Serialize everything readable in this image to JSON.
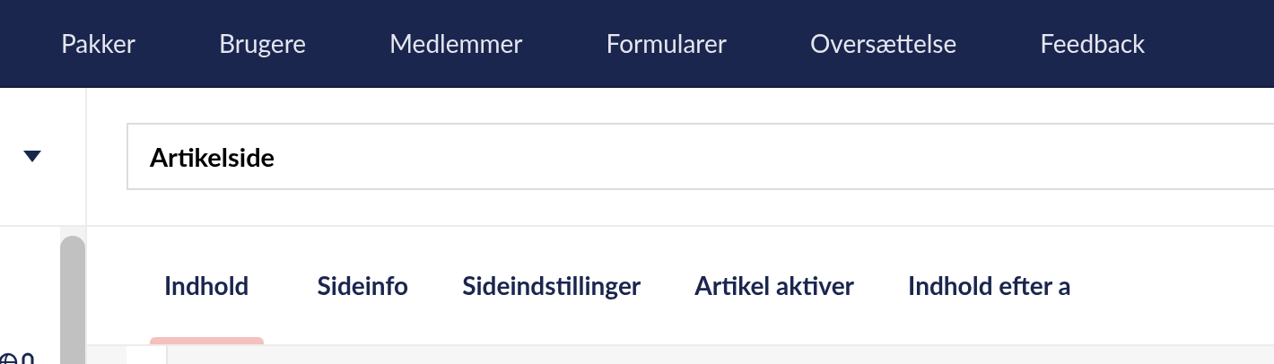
{
  "top_nav": {
    "items": [
      {
        "label": "Pakker"
      },
      {
        "label": "Brugere"
      },
      {
        "label": "Medlemmer"
      },
      {
        "label": "Formularer"
      },
      {
        "label": "Oversættelse"
      },
      {
        "label": "Feedback"
      }
    ]
  },
  "name_field": {
    "value": "Artikelside"
  },
  "tabs": [
    {
      "label": "Indhold",
      "selected": true
    },
    {
      "label": "Sideinfo",
      "selected": false
    },
    {
      "label": "Sideindstillinger",
      "selected": false
    },
    {
      "label": "Artikel aktiver",
      "selected": false
    },
    {
      "label": "Indhold efter a",
      "selected": false
    }
  ]
}
